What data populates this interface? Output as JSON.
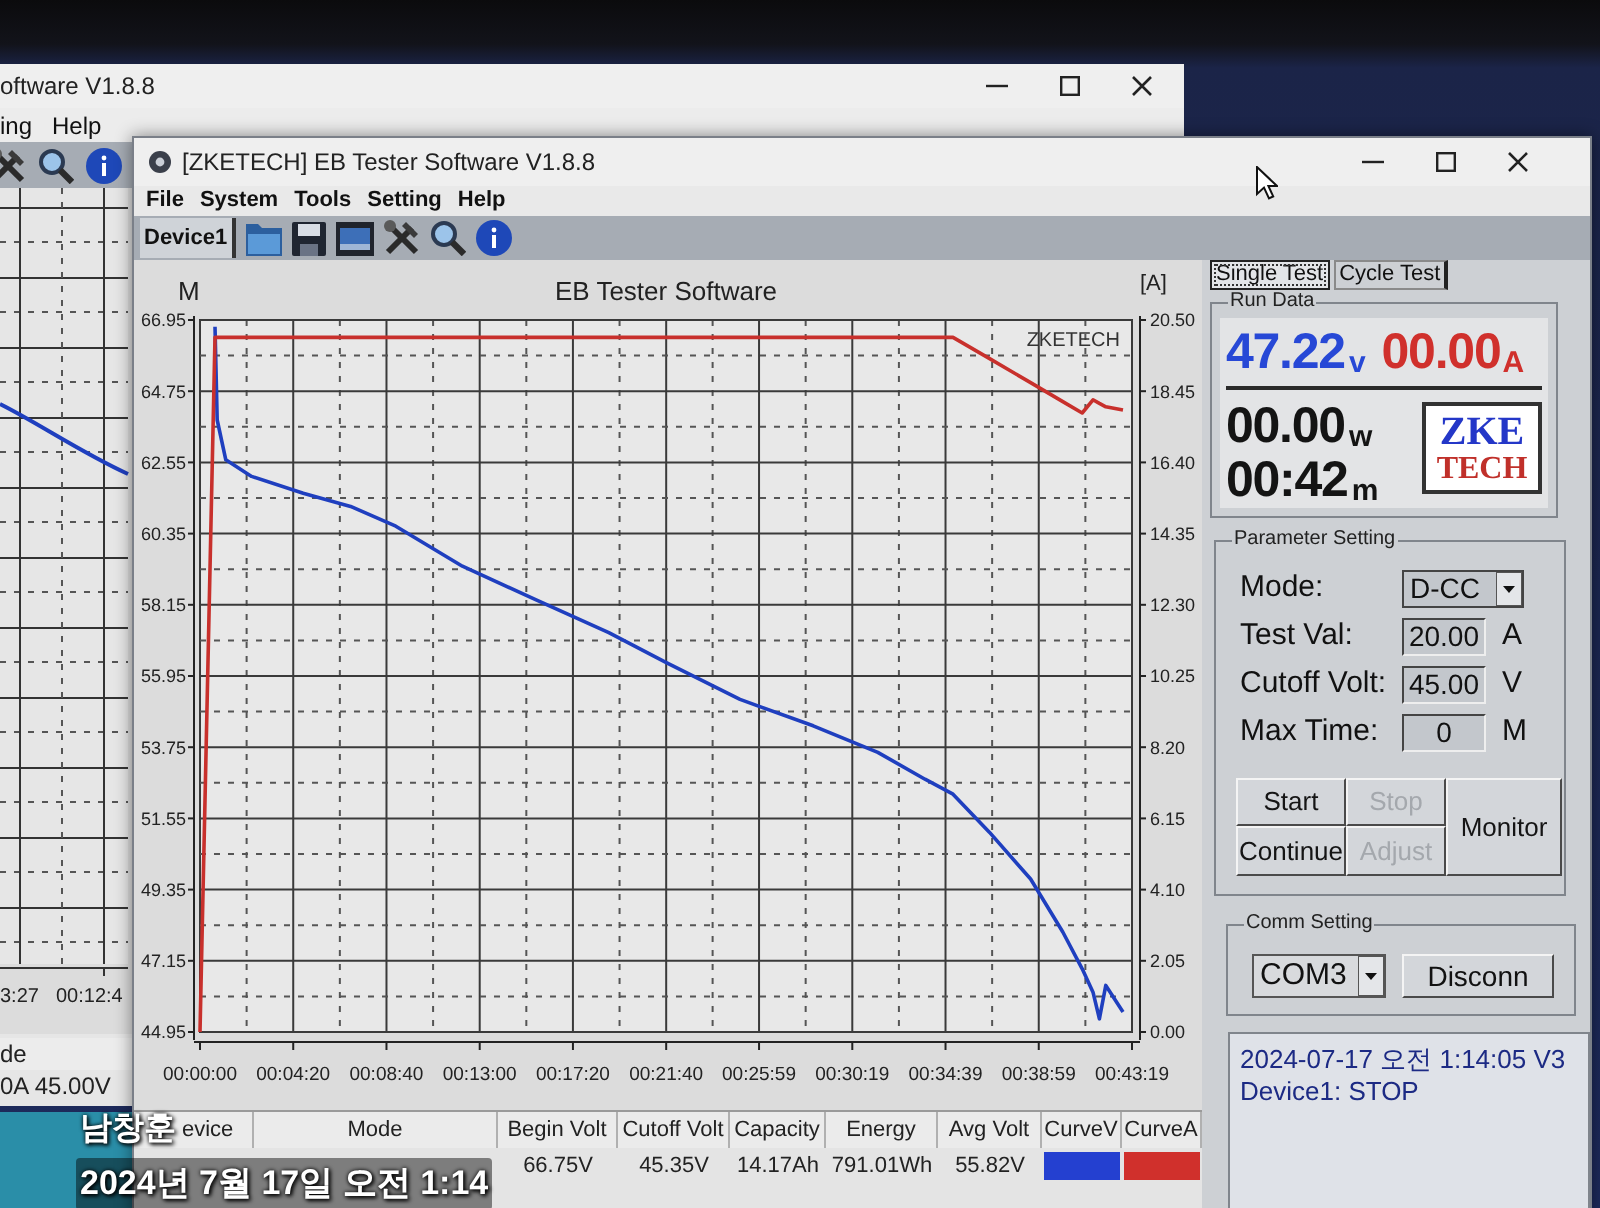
{
  "background_window": {
    "title": "oftware V1.8.8",
    "menu": [
      "ing",
      "Help"
    ],
    "x_labels": [
      "3:27",
      "00:12:4"
    ],
    "table_header": "de",
    "table_cell": "0A 45.00V"
  },
  "main_window": {
    "title": "[ZKETECH] EB Tester Software V1.8.8",
    "menu": [
      "File",
      "System",
      "Tools",
      "Setting",
      "Help"
    ],
    "device_tabs": [
      {
        "label": "Device1",
        "selected": true
      }
    ]
  },
  "chart": {
    "plot_label": "ZKETECH",
    "chart_data": {
      "type": "line",
      "title": "EB Tester Software",
      "ylabel": "M",
      "y2label": "[A]",
      "grid": true,
      "x": [
        0,
        0.7,
        0.8,
        1.2,
        2.4,
        4.8,
        7.0,
        9.1,
        12.2,
        15.6,
        19.0,
        21.7,
        25.1,
        28.5,
        31.5,
        33.7,
        35.0,
        36.7,
        38.6,
        40.1,
        41.0,
        41.5,
        41.8,
        42.1,
        42.9
      ],
      "series": [
        {
          "color": "#1f3fbf",
          "axis": "y",
          "values": [
            null,
            66.74,
            63.86,
            62.63,
            62.12,
            61.6,
            61.19,
            60.58,
            59.34,
            58.31,
            57.29,
            56.36,
            55.23,
            54.41,
            53.59,
            52.76,
            52.3,
            51.12,
            49.68,
            48.04,
            46.9,
            46.18,
            45.36,
            46.39,
            45.57
          ]
        },
        {
          "color": "#c8302c",
          "axis": "y2",
          "values": [
            0,
            20.0,
            20.0,
            20.0,
            20.0,
            20.0,
            20.0,
            20.0,
            20.0,
            20.0,
            20.0,
            20.0,
            20.0,
            20.0,
            20.0,
            20.0,
            20.0,
            19.39,
            18.7,
            18.15,
            17.82,
            18.2,
            18.1,
            18.0,
            17.91
          ]
        }
      ],
      "xlim": [
        0,
        43.317
      ],
      "ylim": [
        44.95,
        66.95
      ],
      "y2lim": [
        0,
        20.5
      ],
      "xticks": [
        {
          "value": 0,
          "label": "00:00:00"
        },
        {
          "value": 4.333,
          "label": "00:04:20"
        },
        {
          "value": 8.667,
          "label": "00:08:40"
        },
        {
          "value": 13,
          "label": "00:13:00"
        },
        {
          "value": 17.333,
          "label": "00:17:20"
        },
        {
          "value": 21.667,
          "label": "00:21:40"
        },
        {
          "value": 25.983,
          "label": "00:25:59"
        },
        {
          "value": 30.317,
          "label": "00:30:19"
        },
        {
          "value": 34.65,
          "label": "00:34:39"
        },
        {
          "value": 38.983,
          "label": "00:38:59"
        },
        {
          "value": 43.317,
          "label": "00:43:19"
        }
      ],
      "yticks": [
        66.95,
        64.75,
        62.55,
        60.35,
        58.15,
        55.95,
        53.75,
        51.55,
        49.35,
        47.15,
        44.95
      ],
      "y2ticks": [
        {
          "value": 20.5,
          "label": "20.50"
        },
        {
          "value": 18.45,
          "label": "18.45"
        },
        {
          "value": 16.4,
          "label": "16.40"
        },
        {
          "value": 14.35,
          "label": "14.35"
        },
        {
          "value": 12.3,
          "label": "12.30"
        },
        {
          "value": 10.25,
          "label": "10.25"
        },
        {
          "value": 8.2,
          "label": "8.20"
        },
        {
          "value": 6.15,
          "label": "6.15"
        },
        {
          "value": 4.1,
          "label": "4.10"
        },
        {
          "value": 2.05,
          "label": "2.05"
        },
        {
          "value": 0,
          "label": "0.00"
        }
      ]
    }
  },
  "results_table": {
    "columns": [
      "evice",
      "Mode",
      "Begin Volt",
      "Cutoff Volt",
      "Capacity",
      "Energy",
      "Avg Volt",
      "CurveV",
      "CurveA"
    ],
    "rows": [
      {
        "cells": [
          {
            "kind": "blank"
          },
          {
            "kind": "blank"
          },
          {
            "kind": "text",
            "text": "66.75V"
          },
          {
            "kind": "text",
            "text": "45.35V"
          },
          {
            "kind": "text",
            "text": "14.17Ah"
          },
          {
            "kind": "text",
            "text": "791.01Wh"
          },
          {
            "kind": "text",
            "text": "55.82V"
          },
          {
            "kind": "swatch",
            "color": "#2440d0"
          },
          {
            "kind": "swatch",
            "color": "#d0302c"
          }
        ]
      }
    ]
  },
  "side_tabs": [
    {
      "label": "Single Test",
      "selected": true
    },
    {
      "label": "Cycle Test",
      "selected": false
    }
  ],
  "run_data": {
    "title": "Run Data",
    "voltage": {
      "value": "47.22",
      "unit": "v"
    },
    "current": {
      "value": "00.00",
      "unit": "A"
    },
    "power": {
      "value": "00.00",
      "unit": "w"
    },
    "time": {
      "value": "00:42",
      "unit": "m"
    },
    "logo": {
      "line_1": "ZKE",
      "line_2": "TECH"
    }
  },
  "parameter_setting": {
    "title": "Parameter Setting",
    "fields": [
      {
        "kind": "dropdown",
        "label": "Mode:",
        "value": "D-CC"
      },
      {
        "kind": "input",
        "label": "Test Val:",
        "value": "20.00",
        "unit": "A"
      },
      {
        "kind": "input",
        "label": "Cutoff Volt:",
        "value": "45.00",
        "unit": "V"
      },
      {
        "kind": "input",
        "label": "Max Time:",
        "value": "0",
        "unit": "M"
      }
    ],
    "buttons": [
      {
        "label": "Start",
        "disabled": false
      },
      {
        "label": "Stop",
        "disabled": true
      },
      {
        "label": "Continue",
        "disabled": false
      },
      {
        "label": "Adjust",
        "disabled": true
      },
      {
        "label": "Monitor",
        "disabled": false
      }
    ]
  },
  "comm_setting": {
    "title": "Comm Setting",
    "port": "COM3",
    "button": "Disconn"
  },
  "log": {
    "lines": [
      "2024-07-17 오전 1:14:05 V3",
      "Device1: STOP"
    ]
  },
  "photo_stamp": {
    "name": "남창훈",
    "timestamp": "2024년 7월 17일 오전 1:14"
  }
}
